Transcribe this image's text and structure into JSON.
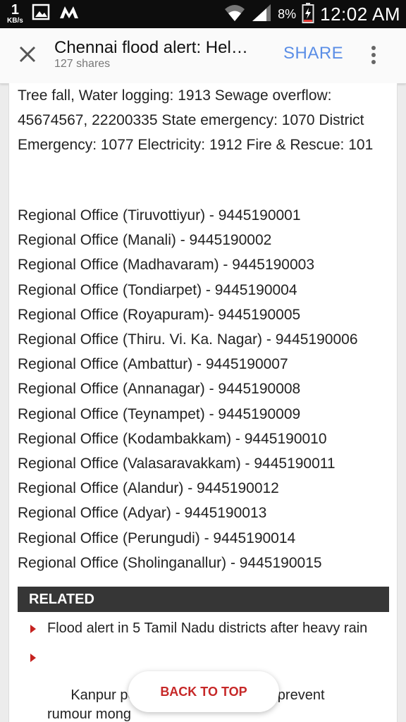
{
  "status_bar": {
    "data_rate": "1",
    "data_unit": "KB/s",
    "battery_percent": "8%",
    "time": "12:02 AM"
  },
  "app_bar": {
    "title": "Chennai flood alert: Hel…",
    "shares": "127 shares",
    "share_label": "SHARE"
  },
  "article": {
    "intro": "Tree fall, Water logging: 1913 Sewage overflow: 45674567, 22200335 State emergency: 1070 District Emergency: 1077 Electricity: 1912 Fire & Rescue: 101",
    "offices": [
      "Regional Office (Tiruvottiyur) - 9445190001",
      "Regional Office (Manali) - 9445190002",
      "Regional Office (Madhavaram) - 9445190003",
      "Regional Office (Tondiarpet) - 9445190004",
      "Regional Office (Royapuram)- 9445190005",
      "Regional Office (Thiru. Vi. Ka. Nagar) - 9445190006",
      "Regional Office (Ambattur) - 9445190007",
      "Regional Office (Annanagar) - 9445190008",
      "Regional Office (Teynampet) - 9445190009",
      "Regional Office (Kodambakkam) - 9445190010",
      "Regional Office (Valasaravakkam) - 9445190011",
      "Regional Office (Alandur) - 9445190012",
      "Regional Office (Adyar) - 9445190013",
      "Regional Office (Perungudi) - 9445190014",
      "Regional Office (Sholinganallur) - 9445190015"
    ]
  },
  "related": {
    "heading": "RELATED",
    "items": [
      "Flood alert in 5 Tamil Nadu districts after heavy rain",
      "Kanpur police i                 bers to prevent rumour mong"
    ]
  },
  "back_to_top_label": "BACK TO TOP",
  "colors": {
    "share": "#5b8ee6",
    "bullet": "#c5221f",
    "back_to_top": "#c62828",
    "related_header": "#363636"
  },
  "icons": [
    "image-icon",
    "app-m-icon",
    "wifi-icon",
    "signal-icon",
    "battery-icon",
    "close-icon",
    "overflow-menu-icon"
  ]
}
